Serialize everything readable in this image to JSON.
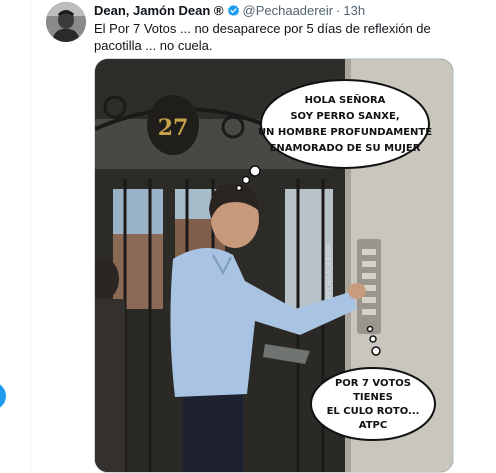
{
  "tweet": {
    "author_name": "Dean, Jamón Dean ®",
    "handle": "@Pechaadereir",
    "separator": "·",
    "time": "13h",
    "text": "El Por 7 Votos ... no desaparece por 5 días de reflexión de pacotilla ... no cuela."
  },
  "image": {
    "door_number": "27",
    "top_bubble": [
      "HOLA SEÑORA",
      "SOY PERRO SANXE,",
      "UN HOMBRE PROFUNDAMENTE",
      "ENAMORADO DE SU MUJER"
    ],
    "bottom_bubble": [
      "POR 7 VOTOS",
      "TIENES",
      "EL CULO ROTO...",
      "ATPC"
    ],
    "watermark": "PECHAADEREIR"
  },
  "icons": {
    "verified": "verified-badge-icon",
    "avatar": "user-avatar"
  },
  "colors": {
    "accent": "#1d9bf0",
    "secondary_text": "#536471",
    "border": "#eff3f4"
  }
}
